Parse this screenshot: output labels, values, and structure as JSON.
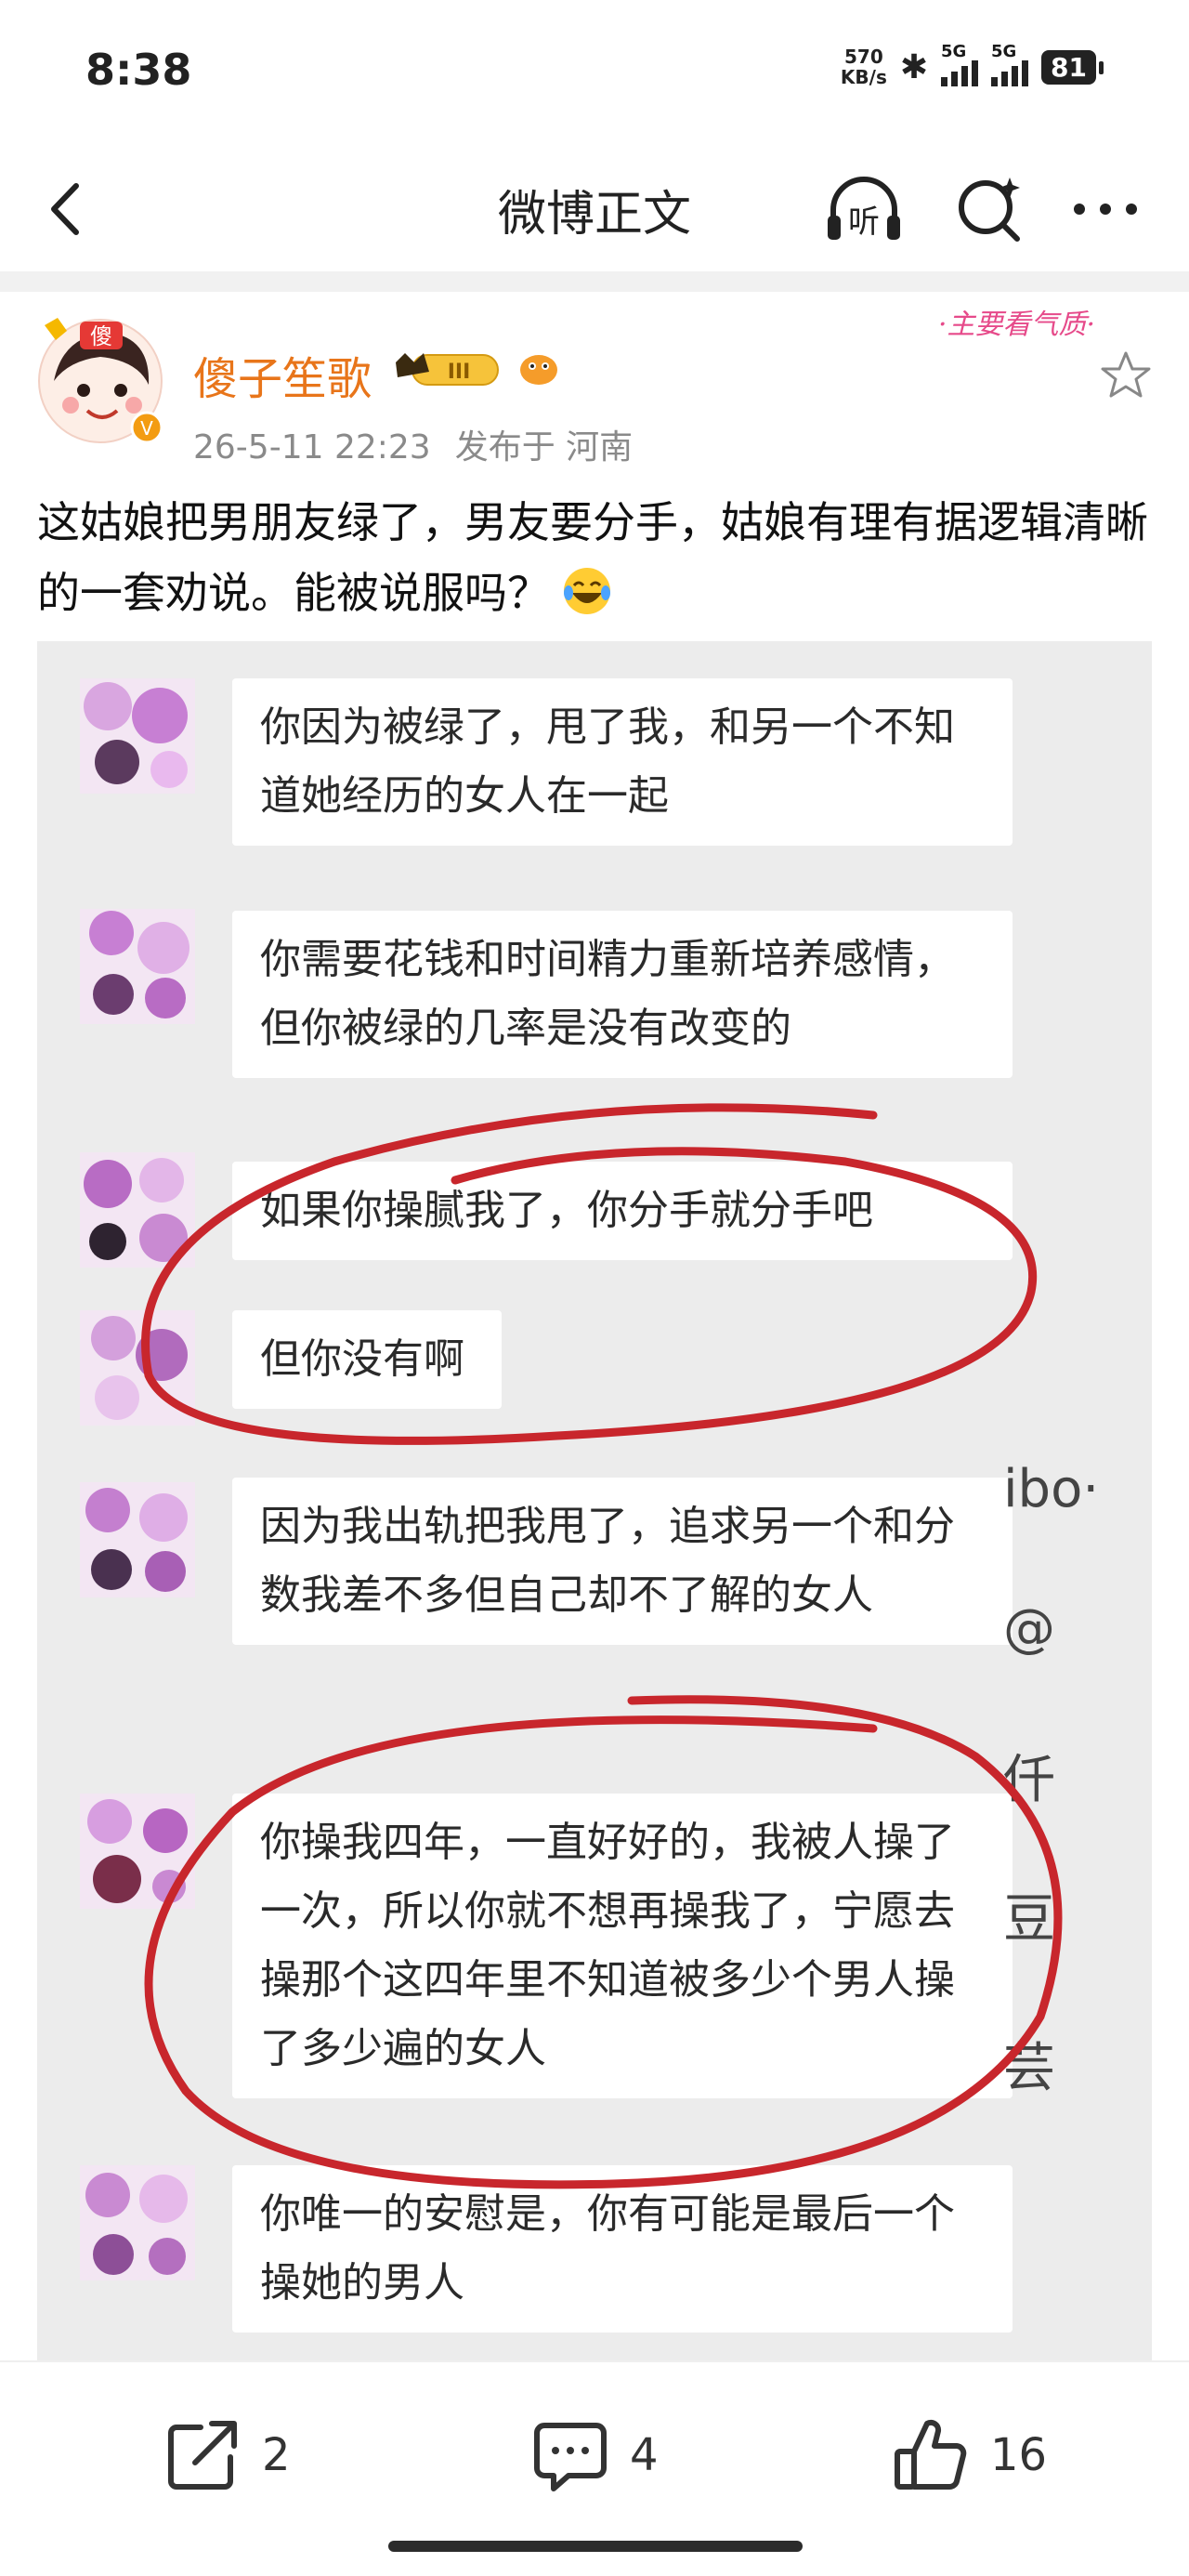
{
  "status": {
    "time": "8:38",
    "net_speed_value": "570",
    "net_speed_unit": "KB/s",
    "sim1_label": "5G",
    "sim2_label": "5G",
    "battery": "81"
  },
  "nav": {
    "title": "微博正文",
    "listen_label": "听"
  },
  "author": {
    "name": "傻子笙歌",
    "badge_level": "III",
    "date": "26-5-11 22:23",
    "source": "发布于 河南",
    "avatar_tag": "傻",
    "sticker_text": "·主要看气质·"
  },
  "post": {
    "text": "这姑娘把男朋友绿了，男友要分手，姑娘有理有据逻辑清晰的一套劝说。能被说服吗？"
  },
  "chat": {
    "messages": [
      "你因为被绿了，甩了我，和另一个不知道她经历的女人在一起",
      "你需要花钱和时间精力重新培养感情，但你被绿的几率是没有改变的",
      "如果你操腻我了，你分手就分手吧",
      "但你没有啊",
      "因为我出轨把我甩了，追求另一个和分数我差不多但自己却不了解的女人",
      "你操我四年，一直好好的，我被人操了一次，所以你就不想再操我了，宁愿去操那个这四年里不知道被多少个男人操了多少遍的女人",
      "你唯一的安慰是，你有可能是最后一个操她的男人"
    ],
    "watermark_bits": [
      "ibo·",
      "@",
      "仟",
      "豆",
      "芸"
    ]
  },
  "actions": {
    "repost_count": "2",
    "comment_count": "4",
    "like_count": "16"
  },
  "colors": {
    "author_orange": "#e8751a",
    "circle_red": "#c8262c",
    "meta_gray": "#8a8a8a"
  }
}
